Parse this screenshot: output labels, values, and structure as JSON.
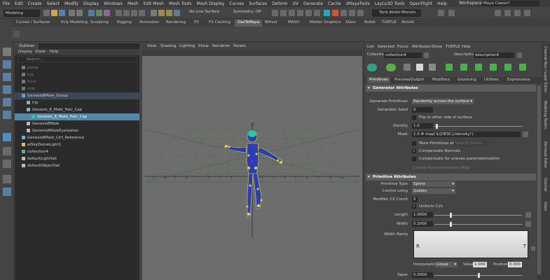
{
  "menubar": {
    "items": [
      "File",
      "Edit",
      "Create",
      "Select",
      "Modify",
      "Display",
      "Windows",
      "Mesh",
      "Edit Mesh",
      "Mesh Tools",
      "Mesh Display",
      "Curves",
      "Surfaces",
      "Deform",
      "UV",
      "Generate",
      "Cache",
      "zMayaTools",
      "LayLo3D Tools",
      "OpenFlight",
      "Help"
    ],
    "workspace_label": "Workspace :",
    "workspace_value": "Maya Classic*"
  },
  "statusline": {
    "mode": "Modeling",
    "live_surface": "No Live Surface",
    "symmetry": "Symmetry: Off",
    "user": "Tarik Abdel Monem"
  },
  "shelf": {
    "tabs": [
      "Curves / Surfaces",
      "Poly Modeling",
      "Sculpting",
      "Rigging",
      "Animation",
      "Rendering",
      "FX",
      "FX Caching",
      "DazToMaya",
      "Bifrost",
      "MASH",
      "Motion Graphics",
      "XGen",
      "Bullet",
      "TURTLE",
      "Arnold"
    ],
    "active_tab": "DazToMaya"
  },
  "outliner": {
    "tab": "Outliner",
    "menu": [
      "Display",
      "Show",
      "Help"
    ],
    "search_placeholder": "Search...",
    "items": [
      {
        "label": "persp",
        "indent": 0,
        "state": "dim"
      },
      {
        "label": "top",
        "indent": 0,
        "state": "dim"
      },
      {
        "label": "front",
        "indent": 0,
        "state": "dim"
      },
      {
        "label": "side",
        "indent": 0,
        "state": "dim"
      },
      {
        "label": "Genesis8Male_Group",
        "indent": 0,
        "state": "hl"
      },
      {
        "label": "hip",
        "indent": 1,
        "state": ""
      },
      {
        "label": "Genesis_8_Male_Hair_Cap",
        "indent": 1,
        "state": ""
      },
      {
        "label": "Genesis_8_Male_Hair_Cap",
        "indent": 2,
        "state": "sel"
      },
      {
        "label": "Genesis8Male",
        "indent": 1,
        "state": ""
      },
      {
        "label": "Genesis8MaleEyelashes",
        "indent": 1,
        "state": ""
      },
      {
        "label": "Genesis8Male_Ctrl_Reference",
        "indent": 0,
        "state": ""
      },
      {
        "label": "aiSkyDomeLight1",
        "indent": 0,
        "state": ""
      },
      {
        "label": "collection4",
        "indent": 0,
        "state": ""
      },
      {
        "label": "defaultLightSet",
        "indent": 0,
        "state": ""
      },
      {
        "label": "defaultObjectSet",
        "indent": 0,
        "state": ""
      }
    ]
  },
  "viewport": {
    "menu": [
      "View",
      "Shading",
      "Lighting",
      "Show",
      "Renderer",
      "Panels"
    ]
  },
  "attribute_editor": {
    "menu": [
      "List",
      "Selected",
      "Focus",
      "Attributes",
      "Show",
      "TURTLE",
      "Help"
    ],
    "collection_label": "Collection",
    "collection_value": "collection4",
    "description_label": "Description",
    "description_value": "description4",
    "tabs": [
      "Primitives",
      "Preview/Output",
      "Modifiers",
      "Grooming",
      "Utilities",
      "Expressions"
    ],
    "active_tab": "Primitives",
    "generator": {
      "section": "Generator Attributes",
      "generate_primitives_label": "Generate Primitives",
      "generate_primitives_value": "Randomly across the surface",
      "seed_label": "Generator Seed",
      "seed_value": "0",
      "flip_label": "Flip to other side of surface",
      "density_label": "Density",
      "density_value": "1.0",
      "mask_label": "Mask",
      "mask_value": "1.0 # map('${DESC}/density/')",
      "more_primitives_label": "More Primitives at",
      "specify_points_label": "Specify Points...",
      "compensate_normals_label": "Compensate Normals",
      "compensate_uneven_label": "Compensate for uneven parameterization",
      "create_map_label": "Create Parameterization Map"
    },
    "primitive": {
      "section": "Primitive Attributes",
      "type_label": "Primitive Type",
      "type_value": "Spline",
      "control_label": "Control using",
      "control_value": "Guides",
      "cv_count_label": "Modifier CV Count",
      "cv_count_value": "5",
      "uniform_cvs_label": "Uniform CVs",
      "length_label": "Length",
      "length_value": "1.0000",
      "width_label": "Width",
      "width_value": "0.1000",
      "ramp_label": "Width Ramp",
      "ramp_left": "R",
      "ramp_right": "T",
      "interp_label": "Interpolation",
      "interp_value": "Linear",
      "value_label": "Value",
      "value_value": "1.000",
      "position_label": "Position",
      "position_value": "0.000",
      "taper_label": "Taper",
      "taper_value": "0.0000"
    }
  },
  "right_tabs": [
    "Channel Box / Layer Editor",
    "Modeling Toolkit",
    "Attribute Editor",
    "Outliner",
    "XGen"
  ],
  "colors": {
    "accent_selection": "#5285a6",
    "viewport_bg": "#6d6d6d",
    "rig_yellow": "#d8d83a",
    "rig_blue": "#2d3db8",
    "hair_cap": "#2ec8a8"
  }
}
